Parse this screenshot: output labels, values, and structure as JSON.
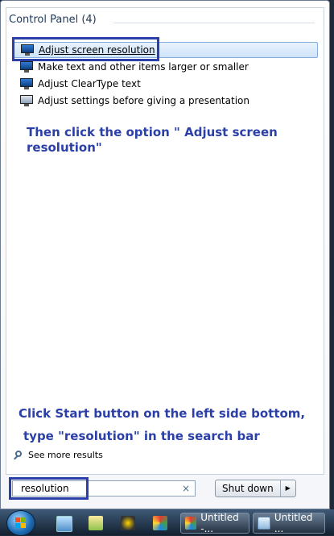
{
  "results": {
    "group_header": "Control Panel (4)",
    "items": [
      {
        "label": "Adjust screen resolution",
        "icon": "monitor-icon"
      },
      {
        "label": "Make text and other items larger or smaller",
        "icon": "monitor-icon"
      },
      {
        "label": "Adjust ClearType text",
        "icon": "monitor-icon"
      },
      {
        "label": "Adjust settings before giving a presentation",
        "icon": "presentation-icon"
      }
    ],
    "see_more": "See more results"
  },
  "annotations": {
    "step2": "Then click the option \" Adjust screen resolution\"",
    "step1_line1": "Click Start button on the left side bottom,",
    "step1_line2": "type \"resolution\" in the search bar"
  },
  "search": {
    "value": "resolution",
    "clear_glyph": "×"
  },
  "shutdown": {
    "label": "Shut down",
    "arrow_glyph": "▶"
  },
  "taskbar": {
    "tasks": [
      {
        "label": "Untitled -..."
      },
      {
        "label": "Untitled ..."
      }
    ]
  },
  "colors": {
    "annotation": "#2b3fa8",
    "selection": "#cfe3f8"
  }
}
